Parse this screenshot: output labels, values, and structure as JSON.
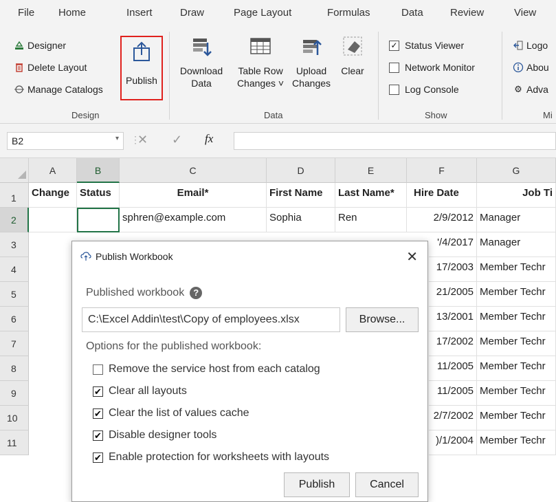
{
  "ribbon_tabs": [
    "File",
    "Home",
    "Insert",
    "Draw",
    "Page Layout",
    "Formulas",
    "Data",
    "Review",
    "View"
  ],
  "design_group": {
    "items": [
      "Designer",
      "Delete Layout",
      "Manage Catalogs"
    ],
    "publish_label": "Publish",
    "label": "Design"
  },
  "data_group": {
    "download": [
      "Download",
      "Data"
    ],
    "table_row": [
      "Table Row",
      "Changes ˅"
    ],
    "upload": [
      "Upload",
      "Changes"
    ],
    "clear": "Clear",
    "label": "Data"
  },
  "show_group": {
    "items": [
      {
        "label": "Status Viewer",
        "checked": true
      },
      {
        "label": "Network Monitor",
        "checked": false
      },
      {
        "label": "Log Console",
        "checked": false
      }
    ],
    "label": "Show"
  },
  "misc_group": {
    "items": [
      "Logo",
      "Abou",
      "Adva"
    ],
    "label": "Mi"
  },
  "formula_bar": {
    "name_box": "B2",
    "fx": "fx"
  },
  "columns": [
    "A",
    "B",
    "C",
    "D",
    "E",
    "F",
    "G"
  ],
  "rows": [
    "1",
    "2",
    "3",
    "4",
    "5",
    "6",
    "7",
    "8",
    "9",
    "10",
    "11"
  ],
  "header_row": [
    "Change",
    "Status",
    "Email*",
    "First Name",
    "Last Name*",
    "Hire Date",
    "Job Ti"
  ],
  "row2": {
    "email": "sphren@example.com",
    "first": "Sophia",
    "last": "Ren",
    "hire": "2/9/2012",
    "job": "Manager"
  },
  "partial_rows": [
    {
      "hire": "'/4/2017",
      "job": "Manager"
    },
    {
      "hire": "17/2003",
      "job": "Member Techr"
    },
    {
      "hire": "21/2005",
      "job": "Member Techr"
    },
    {
      "hire": "13/2001",
      "job": "Member Techr"
    },
    {
      "hire": "17/2002",
      "job": "Member Techr"
    },
    {
      "hire": "11/2005",
      "job": "Member Techr"
    },
    {
      "hire": "11/2005",
      "job": "Member Techr"
    },
    {
      "hire": "2/7/2002",
      "job": "Member Techr"
    },
    {
      "hire": ")/1/2004",
      "job": "Member Techr"
    }
  ],
  "dialog": {
    "title": "Publish Workbook",
    "published_label": "Published workbook",
    "path": "C:\\Excel Addin\\test\\Copy of employees.xlsx",
    "browse": "Browse...",
    "options_label": "Options for the published workbook:",
    "options": [
      {
        "label": "Remove the service host from each catalog",
        "checked": false
      },
      {
        "label": "Clear all layouts",
        "checked": true
      },
      {
        "label": "Clear the list of values cache",
        "checked": true
      },
      {
        "label": "Disable designer tools",
        "checked": true
      },
      {
        "label": "Enable protection for worksheets with layouts",
        "checked": true
      }
    ],
    "publish": "Publish",
    "cancel": "Cancel"
  }
}
